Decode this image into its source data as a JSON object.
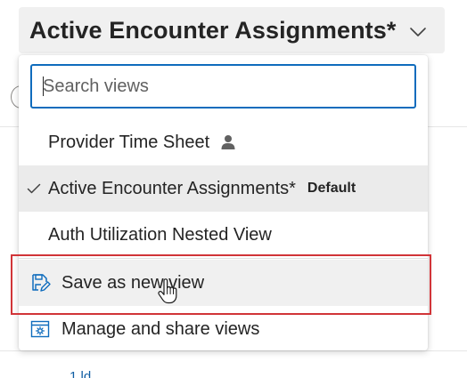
{
  "header": {
    "title": "Active Encounter Assignments*"
  },
  "search": {
    "placeholder": "Search views",
    "value": ""
  },
  "views": [
    {
      "label": "Provider Time Sheet",
      "personal": true,
      "selected": false,
      "badge": ""
    },
    {
      "label": "Active Encounter Assignments*",
      "personal": false,
      "selected": true,
      "badge": "Default"
    },
    {
      "label": "Auth Utilization Nested View",
      "personal": false,
      "selected": false,
      "badge": ""
    }
  ],
  "actions": {
    "save_as_new": "Save as new view",
    "manage": "Manage and share views"
  },
  "colors": {
    "accent": "#0f6cbd",
    "highlight_border": "#d13438",
    "selected_bg": "#ebebeb",
    "hover_bg": "#f0f0f0"
  }
}
